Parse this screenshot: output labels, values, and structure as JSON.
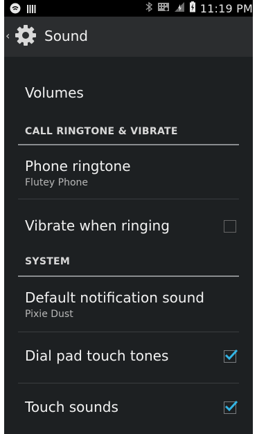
{
  "status_bar": {
    "time": "11:19 PM",
    "icons": [
      "wifi-hotspot-icon",
      "signal-bars-icon",
      "bluetooth-icon",
      "nfc-icon",
      "data-icon",
      "battery-charging-icon"
    ]
  },
  "action_bar": {
    "title": "Sound",
    "icon": "gear-icon",
    "back": "chevron-left-icon"
  },
  "list": {
    "volumes": "Volumes",
    "section_call": "CALL RINGTONE & VIBRATE",
    "phone_ringtone": {
      "title": "Phone ringtone",
      "summary": "Flutey Phone"
    },
    "vibrate": {
      "title": "Vibrate when ringing",
      "checked": false
    },
    "section_system": "SYSTEM",
    "notification": {
      "title": "Default notification sound",
      "summary": "Pixie Dust"
    },
    "dial_pad": {
      "title": "Dial pad touch tones",
      "checked": true
    },
    "touch_sounds": {
      "title": "Touch sounds",
      "checked": true
    }
  },
  "colors": {
    "background": "#1d2022",
    "accent_check": "#33b5e5",
    "text": "#f2f2f2",
    "subtext": "#b7b7b7"
  }
}
